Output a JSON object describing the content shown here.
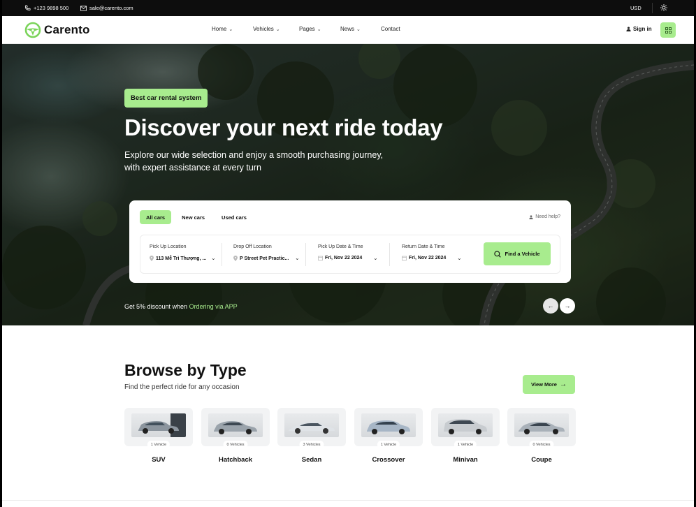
{
  "topbar": {
    "phone": "+123 9898 500",
    "email": "sale@carento.com",
    "currency": "USD"
  },
  "header": {
    "brand": "Carento",
    "nav": [
      {
        "label": "Home",
        "has_dropdown": true
      },
      {
        "label": "Vehicles",
        "has_dropdown": true
      },
      {
        "label": "Pages",
        "has_dropdown": true
      },
      {
        "label": "News",
        "has_dropdown": true
      },
      {
        "label": "Contact",
        "has_dropdown": false
      }
    ],
    "sign_in": "Sign in"
  },
  "hero": {
    "tag": "Best car rental system",
    "title": "Discover your next ride today",
    "subtitle_line1": "Explore our wide selection and enjoy a smooth purchasing journey,",
    "subtitle_line2": "with expert assistance at every turn",
    "discount_text": "Get 5% discount when ",
    "discount_link": "Ordering via APP"
  },
  "search": {
    "tabs": [
      "All cars",
      "New cars",
      "Used cars"
    ],
    "active_tab": "All cars",
    "help": "Need help?",
    "pickup_location": {
      "label": "Pick Up Location",
      "value": "113 Mễ Trì Thượng, ..."
    },
    "dropoff_location": {
      "label": "Drop Off Location",
      "value": "P Street Pet Practic..."
    },
    "pickup_date": {
      "label": "Pick Up Date & Time",
      "value": "Fri, Nov 22 2024"
    },
    "return_date": {
      "label": "Return Date & Time",
      "value": "Fri, Nov 22 2024"
    },
    "find_button": "Find a Vehicle"
  },
  "browse": {
    "title": "Browse by Type",
    "subtitle": "Find the perfect ride for any occasion",
    "view_more": "View More",
    "types": [
      {
        "name": "SUV",
        "count": "1 Vehicle"
      },
      {
        "name": "Hatchback",
        "count": "0 Vehicles"
      },
      {
        "name": "Sedan",
        "count": "3 Vehicles"
      },
      {
        "name": "Crossover",
        "count": "1 Vehicle"
      },
      {
        "name": "Minivan",
        "count": "1 Vehicle"
      },
      {
        "name": "Coupe",
        "count": "0 Vehicles"
      }
    ]
  },
  "colors": {
    "accent": "#a8ec8e",
    "dark": "#0d0d0d"
  }
}
